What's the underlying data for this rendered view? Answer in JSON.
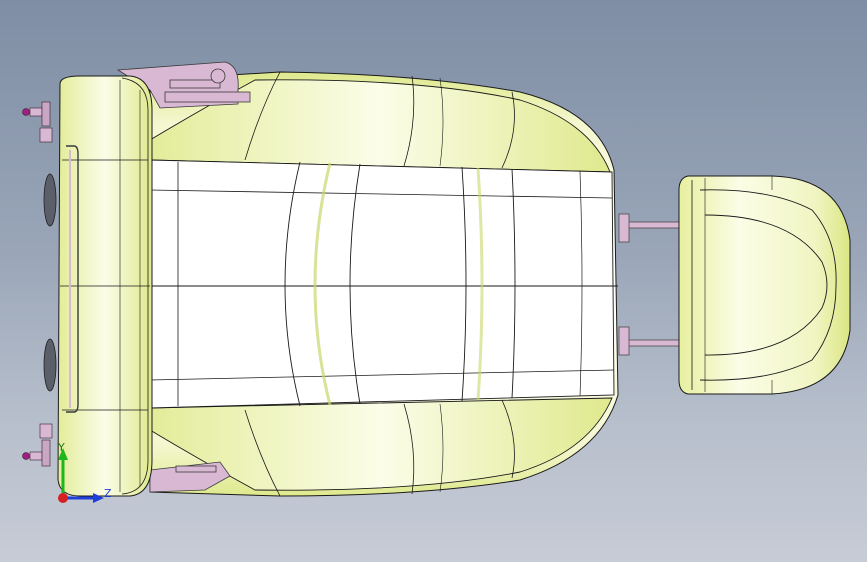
{
  "viewport": {
    "background_top": "#7f8ea5",
    "background_bottom": "#c7ccd6"
  },
  "model": {
    "fill_color": "#f2f5c8",
    "shade_color": "#e1eb8f",
    "edge_color": "#1a1a1a",
    "hardware_color": "#d9b8d3",
    "fastener_color": "#a0207f"
  },
  "triad": {
    "y_label": "Y",
    "z_label": "Z",
    "y_color": "#1fb51f",
    "z_color": "#1f3fd6",
    "origin_color": "#d42020"
  }
}
